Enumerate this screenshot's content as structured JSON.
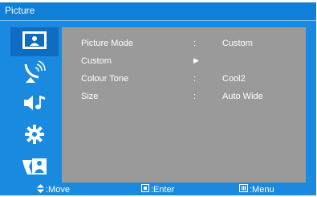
{
  "window": {
    "title": "Picture"
  },
  "sidebar": {
    "items": [
      {
        "icon": "picture-icon",
        "active": true
      },
      {
        "icon": "antenna-icon",
        "active": false
      },
      {
        "icon": "sound-icon",
        "active": false
      },
      {
        "icon": "gear-icon",
        "active": false
      },
      {
        "icon": "input-icon",
        "active": false
      }
    ]
  },
  "menu": {
    "rows": [
      {
        "label": "Picture Mode",
        "sep": ":",
        "value": "Custom"
      },
      {
        "label": "Custom",
        "sep": "▶",
        "value": ""
      },
      {
        "label": "Colour Tone",
        "sep": ":",
        "value": "Cool2"
      },
      {
        "label": "Size",
        "sep": ":",
        "value": "Auto Wide"
      }
    ]
  },
  "footer": {
    "move": ":Move",
    "enter": ":Enter",
    "menu": ":Menu"
  },
  "colors": {
    "frame": "#1a8ae0",
    "panel": "#9a9a9a",
    "active": "#0e6cc2",
    "text": "#ffffff"
  }
}
